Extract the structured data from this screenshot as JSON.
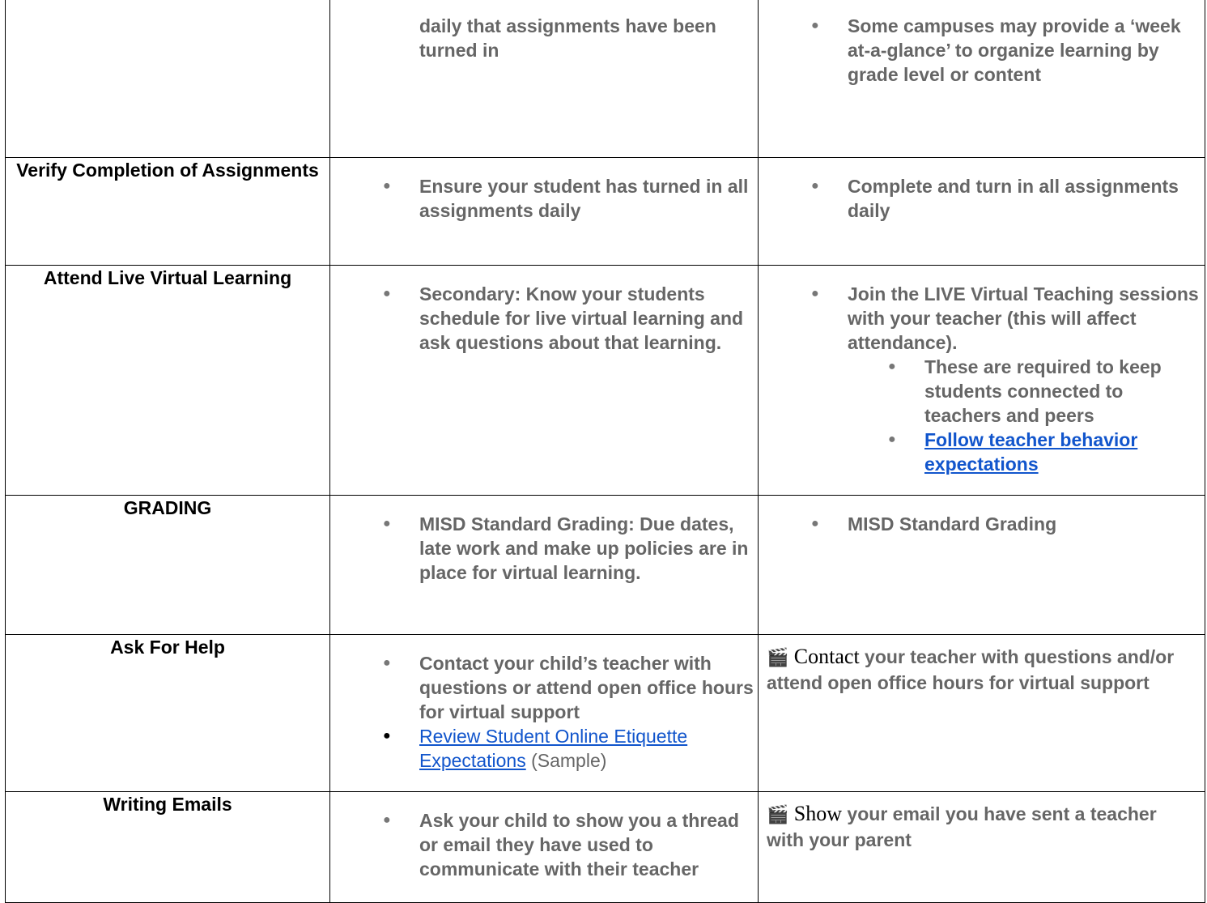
{
  "rows": [
    {
      "title": "",
      "parent": "daily that assignments have been turned in",
      "student": [
        "Some campuses may provide a ‘week at-a-glance’ to organize learning by grade level or content"
      ]
    },
    {
      "title": "Verify Completion of Assignments",
      "parent": [
        "Ensure your student has turned in all assignments daily"
      ],
      "student": [
        "Complete and turn in all assignments daily"
      ]
    },
    {
      "title": "Attend Live Virtual Learning",
      "parent": [
        "Secondary:  Know your students schedule for live virtual learning and ask questions about that learning."
      ],
      "student": [
        "Join the LIVE Virtual Teaching sessions with your teacher (this will affect attendance)."
      ],
      "student_sub": [
        "These are required to keep students connected to teachers and peers"
      ],
      "student_link": "Follow teacher behavior expectations "
    },
    {
      "title": "GRADING",
      "parent": [
        "MISD Standard Grading:  Due dates, late work and make up policies are in place for virtual learning."
      ],
      "student": [
        "MISD Standard Grading"
      ]
    },
    {
      "title": "Ask For Help",
      "parent": [
        "Contact your child’s teacher with questions or attend open office hours for virtual support"
      ],
      "parent_link": "Review Student Online Etiquette Expectations",
      "parent_link_suffix": " (Sample)",
      "student_icon": "clapperboard-icon",
      "student_lead": "Contact",
      "student_text": " your teacher with questions and/or attend open office hours for virtual support"
    },
    {
      "title": "Writing Emails",
      "parent": [
        "Ask your child to show you a thread or email they have used to communicate with their teacher"
      ],
      "student_icon": "clapperboard-icon",
      "student_lead": "Show",
      "student_text": " your email you have sent a teacher with your parent"
    }
  ],
  "colors": {
    "text_gray": "#666666",
    "link_blue": "#1155cc",
    "border": "#000000"
  }
}
